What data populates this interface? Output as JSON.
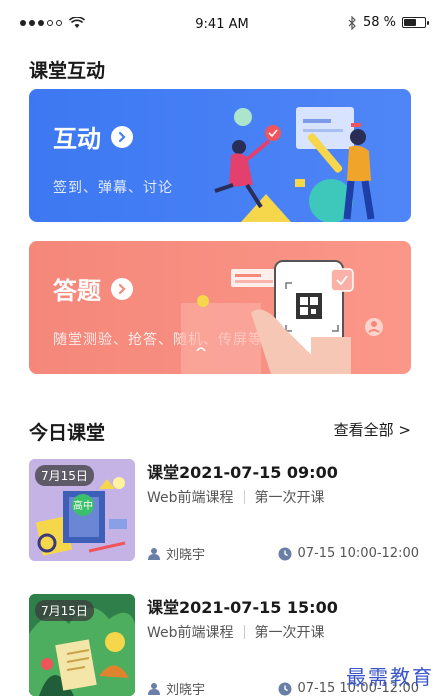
{
  "status_bar": {
    "time": "9:41 AM",
    "battery_text": "58 %",
    "battery_level": 0.58
  },
  "interaction": {
    "section_title": "课堂互动",
    "cards": [
      {
        "title": "互动",
        "subtitle": "签到、弹幕、讨论",
        "color": "#4480f5"
      },
      {
        "title": "答题",
        "subtitle": "随堂测验、抢答、随机、传屏等",
        "color": "#f7897b"
      }
    ]
  },
  "today": {
    "section_title": "今日课堂",
    "see_all": "查看全部 >",
    "courses": [
      {
        "date_tag": "7月15日",
        "title": "课堂2021-07-15 09:00",
        "course_name": "Web前端课程",
        "lesson": "第一次开课",
        "teacher": "刘晓宇",
        "time": "07-15 10:00-12:00"
      },
      {
        "date_tag": "7月15日",
        "title": "课堂2021-07-15 15:00",
        "course_name": "Web前端课程",
        "lesson": "第一次开课",
        "teacher": "刘晓宇",
        "time": "07-15 10:00-12:00"
      }
    ]
  },
  "watermark": "最需教育",
  "cover_badge": "高中"
}
